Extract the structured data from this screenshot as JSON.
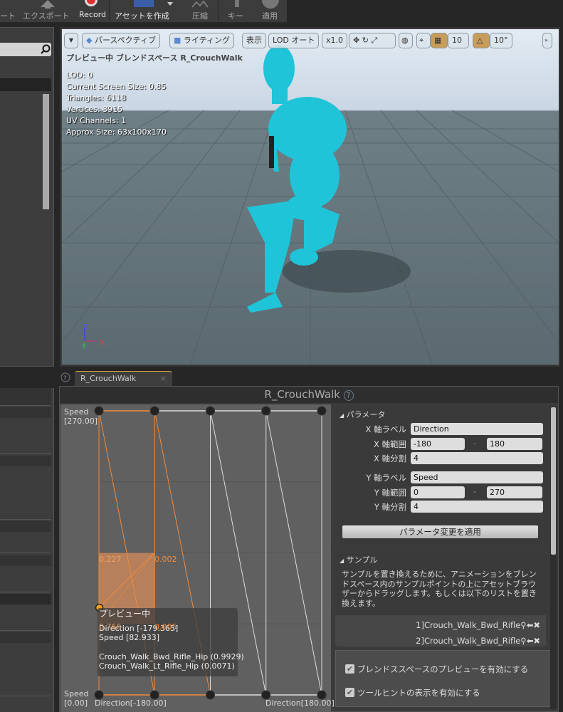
{
  "toolbar": {
    "items": [
      {
        "label": "ート",
        "enabled": false
      },
      {
        "label": "エクスポート",
        "enabled": false
      },
      {
        "label": "Record",
        "enabled": true
      },
      {
        "label": "アセットを作成",
        "enabled": true
      },
      {
        "label": "圧縮",
        "enabled": false
      },
      {
        "label": "キー",
        "enabled": false
      },
      {
        "label": "適用",
        "enabled": false
      }
    ]
  },
  "viewport": {
    "buttons": {
      "perspective": "パースペクティブ",
      "lighting": "ライティング",
      "show": "表示",
      "lod": "LOD オート",
      "speed": "x1.0",
      "grid_snap": "10",
      "rot_snap": "10°"
    },
    "preview_title": "プレビュー中 ブレンドスペース R_CrouchWalk",
    "stats": [
      "LOD: 0",
      "Current Screen Size: 0.85",
      "Triangles: 6118",
      "Vertices: 3915",
      "UV Channels: 1",
      "Approx Size: 63x100x170"
    ],
    "axes": {
      "z": "Z",
      "y": "Y",
      "x": "X"
    }
  },
  "tab": {
    "label": "R_CrouchWalk",
    "close": "×"
  },
  "editor": {
    "title": "R_CrouchWalk",
    "grid": {
      "y_label_top": "Speed",
      "y_max": "[270.00]",
      "y_label_bottom": "Speed",
      "y_min": "[0.00]",
      "x_min": "Direction[-180.00]",
      "x_max": "Direction[180.00]",
      "weights": {
        "tl": "0.227",
        "tr": "0.002",
        "bl": "0.766",
        "br": "0.005"
      },
      "preview_point": {
        "direction": -179.365,
        "speed": 82.933
      },
      "tooltip": {
        "title": "プレビュー中",
        "direction": "Direction [-179.365]",
        "speed": "Speed [82.933]",
        "anim1": "Crouch_Walk_Bwd_Rifle_Hip (0.9929)",
        "anim2": "Crouch_Walk_Lt_Rifle_Hip (0.0071)"
      }
    },
    "params": {
      "header": "パラメータ",
      "x_label_lab": "X 軸ラベル",
      "x_label": "Direction",
      "x_range_lab": "X 軸範囲",
      "x_min": "-180",
      "x_max": "180",
      "x_div_lab": "X 軸分割",
      "x_div": "4",
      "y_label_lab": "Y 軸ラベル",
      "y_label": "Speed",
      "y_range_lab": "Y 軸範囲",
      "y_min": "0",
      "y_max": "270",
      "y_div_lab": "Y 軸分割",
      "y_div": "4",
      "dash": "-",
      "apply": "パラメータ変更を適用"
    },
    "samples": {
      "header": "サンプル",
      "desc": "サンプルを置き換えるために、アニメーションをブレンドスペース内のサンプルポイントの上にアセットブラウザーからドラッグします。もしくは以下のリストを置き換えます。",
      "rows": [
        "1]Crouch_Walk_Bwd_Rifle",
        "2]Crouch_Walk_Bwd_Rifle"
      ]
    },
    "options": {
      "preview": "ブレンドススペースのプレビューを有効にする",
      "preview_checked": true,
      "tooltip": "ツールヒントの表示を有効にする",
      "tooltip_checked": true
    }
  },
  "colors": {
    "accent": "#f08a3c",
    "character": "#1fc4d8"
  }
}
